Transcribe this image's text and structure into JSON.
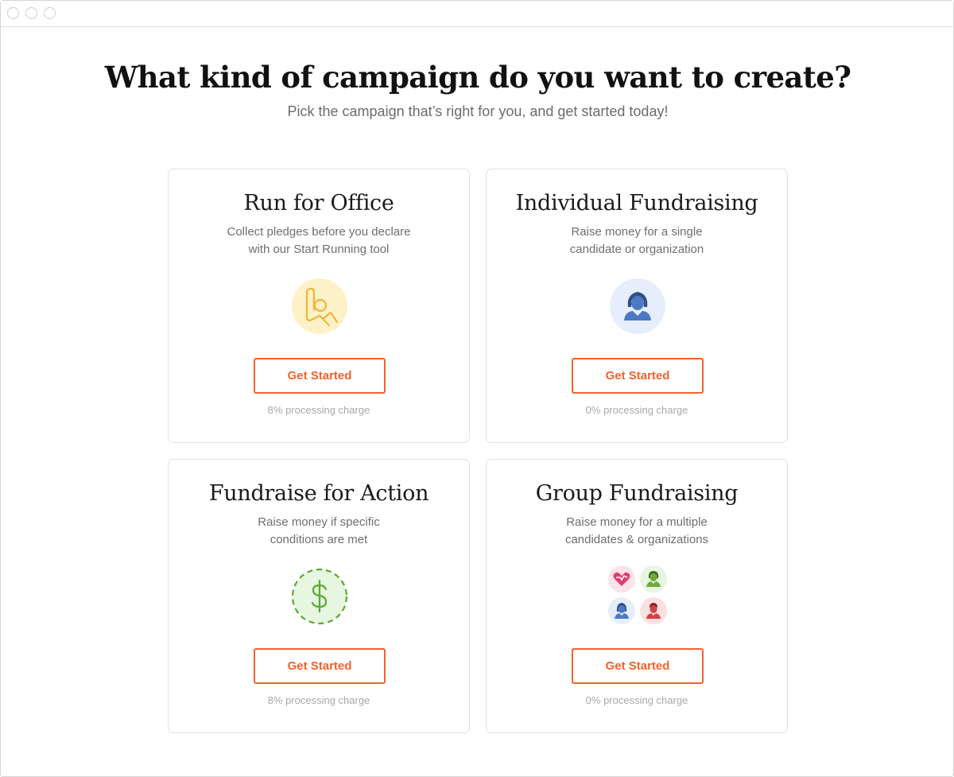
{
  "page": {
    "title": "What kind of campaign do you want to create?",
    "subtitle": "Pick the campaign that’s right for you, and get started today!"
  },
  "colors": {
    "accent": "#f0622d",
    "yellow_circle": "#fdf1c7",
    "blue_circle": "#e6eefb",
    "green_circle": "#e6f6e1"
  },
  "cards": [
    {
      "title": "Run for Office",
      "description_line1": "Collect pledges before you declare",
      "description_line2": "with our Start Running tool",
      "icon": "raised-hand-icon",
      "button_label": "Get Started",
      "fee": "8% processing charge"
    },
    {
      "title": "Individual Fundraising",
      "description_line1": "Raise money for a single",
      "description_line2": "candidate or organization",
      "icon": "person-icon",
      "button_label": "Get Started",
      "fee": "0% processing charge"
    },
    {
      "title": "Fundraise for Action",
      "description_line1": "Raise money if specific",
      "description_line2": "conditions are met",
      "icon": "dollar-icon",
      "button_label": "Get Started",
      "fee": "8% processing charge"
    },
    {
      "title": "Group Fundraising",
      "description_line1": "Raise money for a multiple",
      "description_line2": "candidates & organizations",
      "icon": "group-icon",
      "button_label": "Get Started",
      "fee": "0% processing charge"
    }
  ]
}
